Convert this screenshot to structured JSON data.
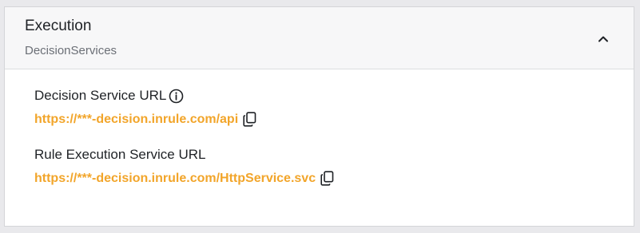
{
  "panel": {
    "title": "Execution",
    "subtitle": "DecisionServices",
    "toggle_icon": "chevron-up-icon"
  },
  "fields": [
    {
      "label": "Decision Service URL",
      "has_info_icon": true,
      "url": "https://***-decision.inrule.com/api",
      "copy_icon": "copy-icon"
    },
    {
      "label": "Rule Execution Service URL",
      "has_info_icon": false,
      "url": "https://***-decision.inrule.com/HttpService.svc",
      "copy_icon": "copy-icon"
    }
  ],
  "colors": {
    "link": "#f2a52a",
    "header_bg": "#f7f7f8",
    "page_bg": "#e9e9ec"
  }
}
